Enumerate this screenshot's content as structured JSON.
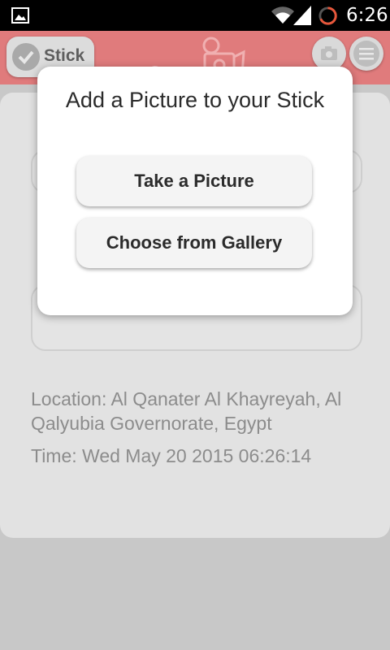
{
  "status_bar": {
    "time": "6:26",
    "icons": [
      "image-icon",
      "wifi-icon",
      "signal-icon",
      "loading-spinner-icon"
    ]
  },
  "header": {
    "stick_button_label": "Stick",
    "icons": [
      "check-icon",
      "logo-icon",
      "camera-icon",
      "menu-icon"
    ]
  },
  "main": {
    "location": "Location: Al Qanater Al Khayreyah, Al Qalyubia Governorate, Egypt",
    "time": "Time: Wed May 20 2015 06:26:14"
  },
  "dialog": {
    "title": "Add a Picture to your Stick",
    "take_picture_label": "Take a Picture",
    "choose_gallery_label": "Choose from Gallery"
  },
  "colors": {
    "header_bg": "#e07b7c",
    "status_bar_bg": "#000000",
    "page_bg": "#c8c8c8",
    "spinner_accent": "#e8563a"
  }
}
